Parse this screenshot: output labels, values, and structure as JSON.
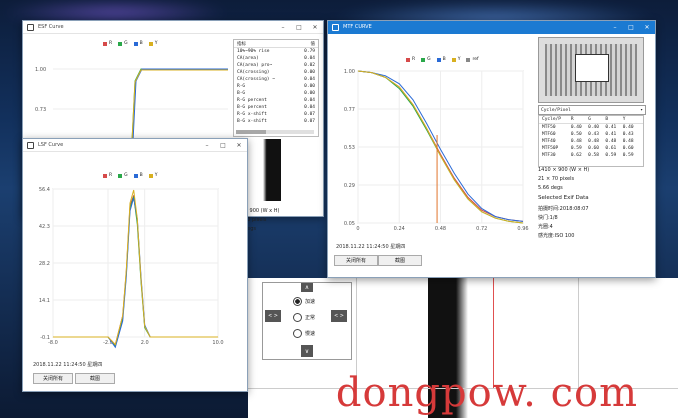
{
  "background": {
    "accent_colors": [
      "#1b3f70",
      "#3b6bd6",
      "#8a4fd0"
    ]
  },
  "esf_window": {
    "title": "ESF Curve",
    "legend": [
      {
        "label": "R",
        "color": "#d64a4a"
      },
      {
        "label": "G",
        "color": "#2aa84a"
      },
      {
        "label": "B",
        "color": "#2a6ad6"
      },
      {
        "label": "Y",
        "color": "#d8b020"
      }
    ],
    "y_ticks": [
      "1.00",
      "0.73"
    ],
    "table_headers": [
      "指标",
      "值"
    ],
    "table_rows": [
      [
        "10%~90% rise",
        "0.79"
      ],
      [
        "CA(area)",
        "0.04"
      ],
      [
        "CA(area) pro~",
        "0.02"
      ],
      [
        "CA(crossing)",
        "0.00"
      ],
      [
        "CA(crossing) ~",
        "0.04"
      ],
      [
        "R-G",
        "0.00"
      ],
      [
        "B-G",
        "0.00"
      ],
      [
        "R-G percent",
        "0.04"
      ],
      [
        "B-G percent",
        "0.04"
      ],
      [
        "R-G x-shift",
        "0.07"
      ],
      [
        "B-G x-shift",
        "0.07"
      ]
    ],
    "partial_lines": [
      "x 900 (W x H)",
      "70 pixels",
      "degs"
    ]
  },
  "lsf_window": {
    "title": "LSF Curve",
    "legend": [
      {
        "label": "R",
        "color": "#d64a4a"
      },
      {
        "label": "G",
        "color": "#2aa84a"
      },
      {
        "label": "B",
        "color": "#2a6ad6"
      },
      {
        "label": "Y",
        "color": "#d8b020"
      }
    ],
    "timestamp": "2018.11.22  11:24:50  星期四",
    "close_all_label": "关闭所有",
    "screenshot_label": "截图"
  },
  "mtf_window": {
    "title": "MTF CURVE",
    "legend": [
      {
        "label": "R",
        "color": "#d64a4a"
      },
      {
        "label": "G",
        "color": "#2aa84a"
      },
      {
        "label": "B",
        "color": "#2a6ad6"
      },
      {
        "label": "Y",
        "color": "#d8b020"
      },
      {
        "label": "ref",
        "color": "#888888"
      }
    ],
    "timestamp": "2018.11.22  11:24:50  星期四",
    "close_all_label": "关闭所有",
    "screenshot_label": "截图",
    "unit_select": "Cycle/Pixel",
    "table_headers": [
      "Cycle/P",
      "R",
      "G",
      "B",
      "Y"
    ],
    "table_rows": [
      [
        "MTF50",
        "0.40",
        "0.40",
        "0.41",
        "0.40"
      ],
      [
        "MTF60",
        "0.50",
        "0.43",
        "0.41",
        "0.43"
      ],
      [
        "MTF40",
        "0.48",
        "0.48",
        "0.48",
        "0.48"
      ],
      [
        "MTF50P",
        "0.59",
        "0.60",
        "0.61",
        "0.60"
      ],
      [
        "MTF30",
        "0.62",
        "0.58",
        "0.59",
        "0.59"
      ]
    ],
    "info": {
      "dims": "1410 × 900 (W × H)",
      "roi": "21 × 70 pixels",
      "angle": "5.66 degs",
      "exif_title": "Selected Exif Data",
      "shot_time": "拍摄时间:2018:08:07",
      "shutter": "快门:1/8",
      "aperture": "光圈:4",
      "iso": "感光度:ISO 100"
    }
  },
  "control_panel": {
    "options": [
      "加速",
      "正常",
      "慢速"
    ],
    "selected_index": 0
  },
  "chart_data": [
    {
      "type": "line",
      "title": "LSF Curve",
      "x_ticks": [
        "-8.0",
        "-2.0",
        "2.0",
        "10.0"
      ],
      "y_ticks": [
        "56.4",
        "42.3",
        "28.2",
        "14.1",
        "-0.1"
      ],
      "xlim": [
        -8.0,
        10.0
      ],
      "ylim": [
        -0.1,
        56.4
      ],
      "series": [
        {
          "name": "R",
          "color": "#d64a4a",
          "x": [
            -8.0,
            -2.0,
            -1.2,
            -0.4,
            0.0,
            0.4,
            0.8,
            1.2,
            1.6,
            2.0,
            2.6,
            10.0
          ],
          "y": [
            -0.1,
            -0.1,
            -3.0,
            8.0,
            25.0,
            50.0,
            54.0,
            44.0,
            22.0,
            4.0,
            -0.1,
            -0.1
          ]
        },
        {
          "name": "G",
          "color": "#2aa84a",
          "x": [
            -8.0,
            -2.0,
            -1.2,
            -0.4,
            0.0,
            0.4,
            0.8,
            1.2,
            1.6,
            2.0,
            2.6,
            10.0
          ],
          "y": [
            -0.1,
            -0.1,
            -3.5,
            7.0,
            24.0,
            49.0,
            53.5,
            43.0,
            21.0,
            3.5,
            -0.1,
            -0.1
          ]
        },
        {
          "name": "B",
          "color": "#2a6ad6",
          "x": [
            -8.0,
            -2.0,
            -1.2,
            -0.4,
            0.0,
            0.4,
            0.8,
            1.2,
            1.6,
            2.0,
            2.6,
            10.0
          ],
          "y": [
            -0.1,
            -0.1,
            -4.0,
            6.0,
            23.0,
            48.0,
            53.0,
            45.0,
            23.0,
            4.5,
            -0.1,
            -0.1
          ]
        },
        {
          "name": "Y",
          "color": "#d8b020",
          "x": [
            -8.0,
            -2.0,
            -1.2,
            -0.4,
            0.0,
            0.4,
            0.8,
            1.2,
            1.6,
            2.0,
            2.6,
            10.0
          ],
          "y": [
            -0.1,
            -0.1,
            -3.0,
            8.0,
            25.5,
            51.0,
            56.0,
            45.0,
            22.0,
            4.0,
            -0.1,
            -0.1
          ]
        }
      ]
    },
    {
      "type": "line",
      "title": "MTF CURVE",
      "x_ticks": [
        "0",
        "0.24",
        "0.48",
        "0.72",
        "0.96"
      ],
      "y_ticks": [
        "1.00",
        "0.77",
        "0.53",
        "0.29",
        "0.05"
      ],
      "xlim": [
        0,
        0.96
      ],
      "ylim": [
        0.05,
        1.0
      ],
      "marker_x": 0.46,
      "series": [
        {
          "name": "R",
          "color": "#d64a4a",
          "x": [
            0,
            0.08,
            0.16,
            0.24,
            0.32,
            0.4,
            0.48,
            0.56,
            0.64,
            0.72,
            0.8,
            0.88,
            0.96
          ],
          "y": [
            1.0,
            0.99,
            0.96,
            0.9,
            0.79,
            0.64,
            0.48,
            0.33,
            0.21,
            0.13,
            0.09,
            0.07,
            0.06
          ]
        },
        {
          "name": "G",
          "color": "#2aa84a",
          "x": [
            0,
            0.08,
            0.16,
            0.24,
            0.32,
            0.4,
            0.48,
            0.56,
            0.64,
            0.72,
            0.8,
            0.88,
            0.96
          ],
          "y": [
            1.0,
            0.99,
            0.96,
            0.89,
            0.78,
            0.63,
            0.47,
            0.32,
            0.2,
            0.12,
            0.08,
            0.06,
            0.05
          ]
        },
        {
          "name": "B",
          "color": "#2a6ad6",
          "x": [
            0,
            0.08,
            0.16,
            0.24,
            0.32,
            0.4,
            0.48,
            0.56,
            0.64,
            0.72,
            0.8,
            0.88,
            0.96
          ],
          "y": [
            1.0,
            0.99,
            0.97,
            0.92,
            0.82,
            0.67,
            0.51,
            0.36,
            0.23,
            0.14,
            0.09,
            0.07,
            0.06
          ]
        },
        {
          "name": "Y",
          "color": "#d8b020",
          "x": [
            0,
            0.08,
            0.16,
            0.24,
            0.32,
            0.4,
            0.48,
            0.56,
            0.64,
            0.72,
            0.8,
            0.88,
            0.96
          ],
          "y": [
            1.0,
            0.99,
            0.96,
            0.9,
            0.79,
            0.64,
            0.47,
            0.32,
            0.2,
            0.12,
            0.08,
            0.06,
            0.05
          ]
        }
      ]
    }
  ]
}
